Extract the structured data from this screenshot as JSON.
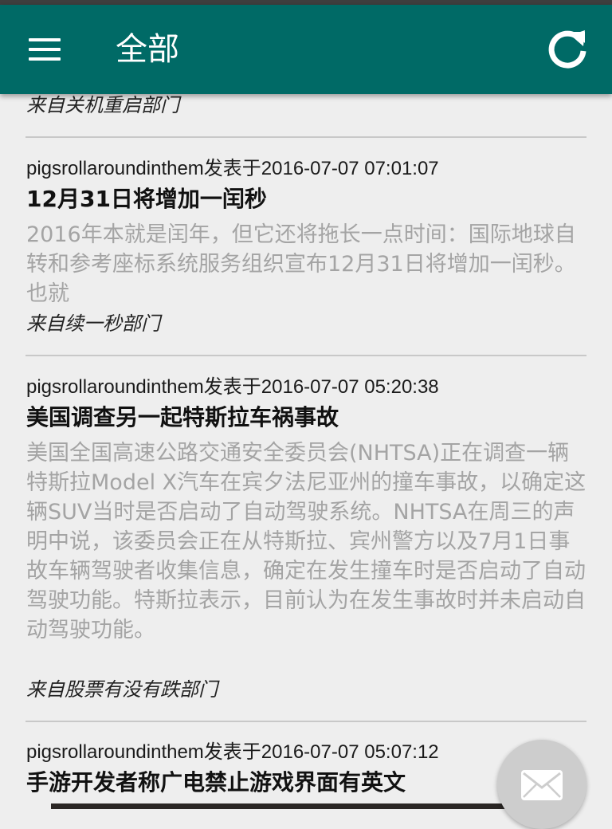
{
  "appbar": {
    "title": "全部",
    "menu_icon": "hamburger-menu-icon",
    "refresh_icon": "refresh-icon",
    "color": "#006a66"
  },
  "posts": [
    {
      "source": "来自关机重启部门"
    },
    {
      "meta": "pigsrollaroundinthem发表于2016-07-07 07:01:07",
      "title": "12月31日将增加一闰秒",
      "summary": "2016年本就是闰年，但它还将拖长一点时间：国际地球自转和参考座标系统服务组织宣布12月31日将增加一闰秒。也就",
      "source": "来自续一秒部门"
    },
    {
      "meta": "pigsrollaroundinthem发表于2016-07-07 05:20:38",
      "title": "美国调查另一起特斯拉车祸事故",
      "summary": "美国全国高速公路交通安全委员会(NHTSA)正在调查一辆特斯拉Model X汽车在宾夕法尼亚州的撞车事故，以确定这辆SUV当时是否启动了自动驾驶系统。NHTSA在周三的声明中说，该委员会正在从特斯拉、宾州警方以及7月1日事故车辆驾驶者收集信息，确定在发生撞车时是否启动了自动驾驶功能。特斯拉表示，目前认为在发生事故时并未启动自动驾驶功能。",
      "source": "来自股票有没有跌部门"
    },
    {
      "meta": "pigsrollaroundinthem发表于2016-07-07 05:07:12",
      "title": "手游开发者称广电禁止游戏界面有英文"
    }
  ],
  "fab": {
    "icon": "mail-icon"
  }
}
